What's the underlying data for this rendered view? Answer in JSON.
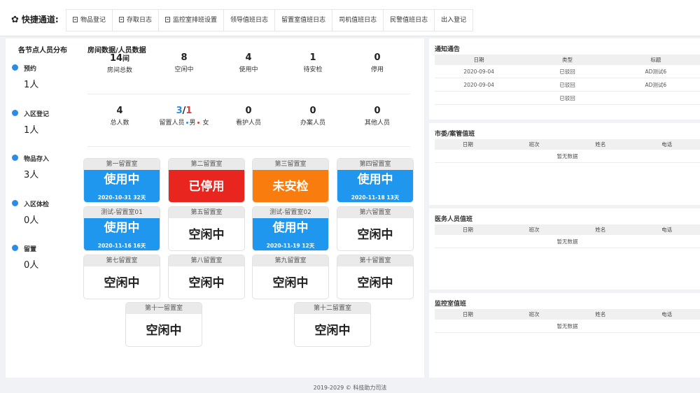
{
  "quick": {
    "title": "快捷通道:",
    "links": [
      "物品登记",
      "存取日志",
      "监控室排班设置",
      "领导值班日志",
      "留置室值班日志",
      "司机值班日志",
      "民警值班日志",
      "出入登记"
    ]
  },
  "nodes": {
    "title": "各节点人员分布",
    "items": [
      {
        "label": "预约",
        "value": "1人"
      },
      {
        "label": "入区登记",
        "value": "1人"
      },
      {
        "label": "物品存入",
        "value": "3人"
      },
      {
        "label": "入区体检",
        "value": "0人"
      },
      {
        "label": "留置",
        "value": "0人"
      }
    ]
  },
  "room_stats": {
    "title": "房间数据/人员数据",
    "row1": [
      {
        "num": "14",
        "unit": "间",
        "label": "房间总数"
      },
      {
        "num": "8",
        "unit": "",
        "label": "空闲中"
      },
      {
        "num": "4",
        "unit": "",
        "label": "使用中"
      },
      {
        "num": "1",
        "unit": "",
        "label": "待安检"
      },
      {
        "num": "0",
        "unit": "",
        "label": "停用"
      }
    ],
    "row2": [
      {
        "num": "4",
        "label": "总人数"
      },
      {
        "num_male": "3",
        "slash": "/",
        "num_female": "1",
        "label": "留置人员",
        "male": "男",
        "female": "女"
      },
      {
        "num": "0",
        "label": "看护人员"
      },
      {
        "num": "0",
        "label": "办案人员"
      },
      {
        "num": "0",
        "label": "其他人员"
      }
    ]
  },
  "rooms": [
    {
      "name": "第一留置室",
      "status": "使用中",
      "sub": "2020-10-31 32天",
      "state": "using"
    },
    {
      "name": "第二留置室",
      "status": "已停用",
      "sub": "",
      "state": "stopped"
    },
    {
      "name": "第三留置室",
      "status": "未安检",
      "sub": "",
      "state": "unchecked"
    },
    {
      "name": "第四留置室",
      "status": "使用中",
      "sub": "2020-11-18 13天",
      "state": "using"
    },
    {
      "name": "测试-留置室01",
      "status": "使用中",
      "sub": "2020-11-16 16天",
      "state": "using"
    },
    {
      "name": "第五留置室",
      "status": "空闲中",
      "sub": "",
      "state": "idle"
    },
    {
      "name": "测试-留置室02",
      "status": "使用中",
      "sub": "2020-11-19 12天",
      "state": "using"
    },
    {
      "name": "第六留置室",
      "status": "空闲中",
      "sub": "",
      "state": "idle"
    },
    {
      "name": "第七留置室",
      "status": "空闲中",
      "sub": "",
      "state": "idle"
    },
    {
      "name": "第八留置室",
      "status": "空闲中",
      "sub": "",
      "state": "idle"
    },
    {
      "name": "第九留置室",
      "status": "空闲中",
      "sub": "",
      "state": "idle"
    },
    {
      "name": "第十留置室",
      "status": "空闲中",
      "sub": "",
      "state": "idle"
    },
    {
      "name": "第十一留置室",
      "status": "空闲中",
      "sub": "",
      "state": "idle"
    },
    {
      "name": "第十二留置室",
      "status": "空闲中",
      "sub": "",
      "state": "idle"
    }
  ],
  "notice": {
    "title": "通知通告",
    "headers": [
      "日期",
      "类型",
      "标题"
    ],
    "rows": [
      [
        "2020-09-04",
        "已驳回",
        "AD测试6"
      ],
      [
        "2020-09-04",
        "已驳回",
        "AD测试6"
      ],
      [
        "",
        "已驳回",
        ""
      ]
    ]
  },
  "duty_tables": [
    {
      "title": "市委/案管值班",
      "headers": [
        "日期",
        "班次",
        "姓名",
        "电话"
      ],
      "empty": "暂无数据"
    },
    {
      "title": "医务人员值班",
      "headers": [
        "日期",
        "班次",
        "姓名",
        "电话"
      ],
      "empty": "暂无数据"
    },
    {
      "title": "监控室值班",
      "headers": [
        "日期",
        "班次",
        "姓名",
        "电话"
      ],
      "empty": "暂无数据"
    }
  ],
  "footer": "2019-2029 © 科技助力司法",
  "colors": {
    "using": "#1f97ee",
    "stopped": "#e8251f",
    "unchecked": "#f97c0f",
    "timeline_dot": "#2a8be8"
  }
}
